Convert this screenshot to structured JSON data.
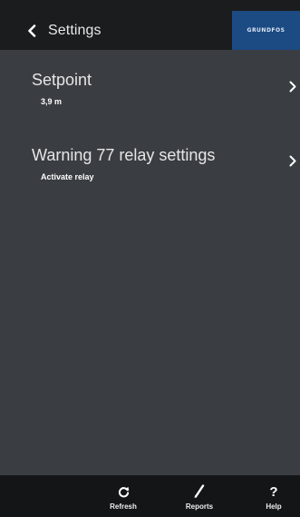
{
  "header": {
    "back_icon": "chevron-left-icon",
    "title": "Settings",
    "brand_logo": "GRUNDFOS"
  },
  "menu": {
    "items": [
      {
        "title": "Setpoint",
        "value": "3,9 m",
        "icon": "chevron-right-icon"
      },
      {
        "title": "Warning 77 relay settings",
        "value": "Activate relay",
        "icon": "chevron-right-icon"
      }
    ]
  },
  "footer": {
    "buttons": [
      {
        "label": "Refresh",
        "icon": "refresh-icon"
      },
      {
        "label": "Reports",
        "icon": "pencil-icon"
      },
      {
        "label": "Help",
        "icon": "help-icon",
        "glyph": "?"
      }
    ]
  },
  "colors": {
    "background": "#3a3d42",
    "header": "#1b1c1e",
    "footer": "#141516",
    "brand": "#1c4a83",
    "text": "#ffffff"
  }
}
